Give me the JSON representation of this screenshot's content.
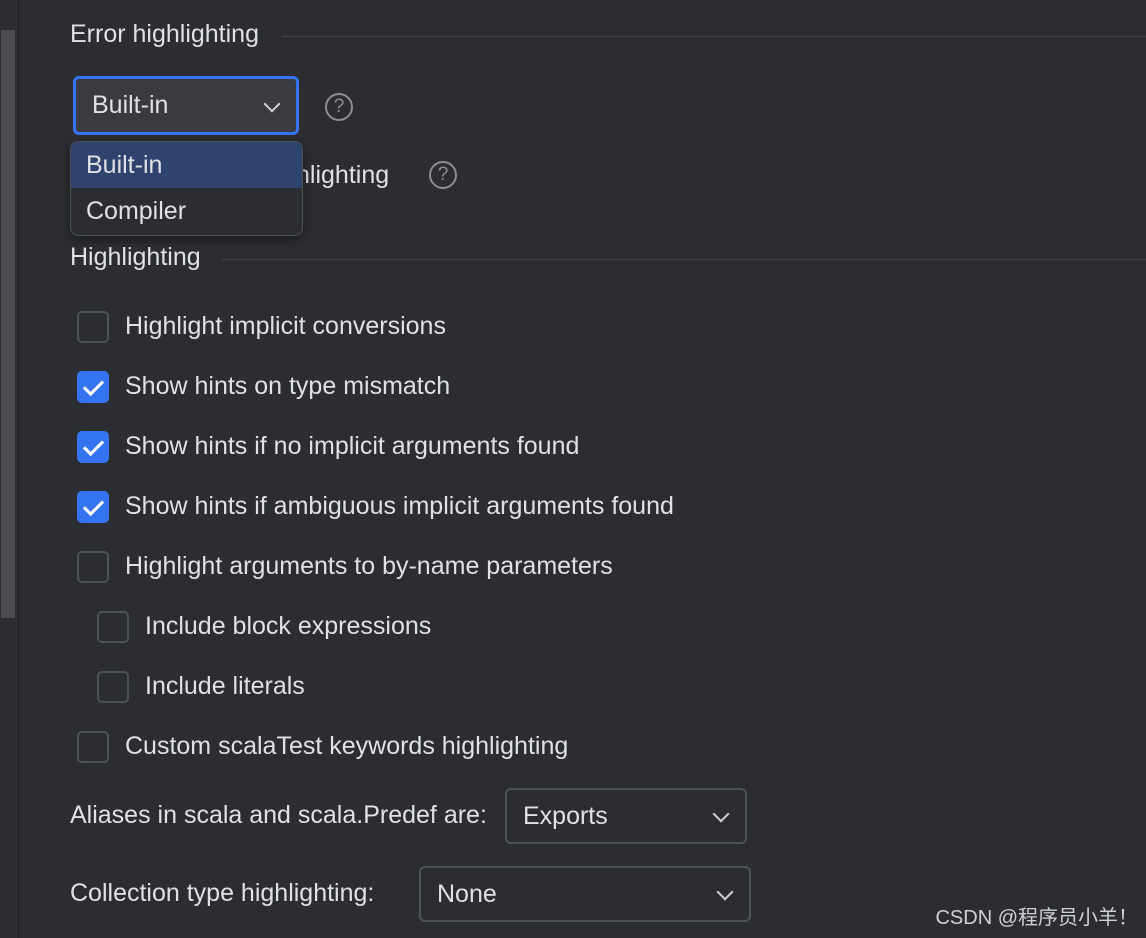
{
  "error_highlighting": {
    "title": "Error highlighting",
    "combo_value": "Built-in",
    "help_icon": "?",
    "partial_label": "hlighting",
    "popup_options": [
      "Built-in",
      "Compiler"
    ],
    "popup_selected": "Built-in"
  },
  "highlighting": {
    "title": "Highlighting",
    "checkboxes": [
      {
        "label": "Highlight implicit conversions",
        "checked": false
      },
      {
        "label": "Show hints on type mismatch",
        "checked": true
      },
      {
        "label": "Show hints if no implicit arguments found",
        "checked": true
      },
      {
        "label": "Show hints if ambiguous implicit arguments found",
        "checked": true
      },
      {
        "label": "Highlight arguments to by-name parameters",
        "checked": false
      },
      {
        "label": "Include block expressions",
        "checked": false
      },
      {
        "label": "Include literals",
        "checked": false
      },
      {
        "label": "Custom scalaTest keywords highlighting",
        "checked": false
      }
    ]
  },
  "aliases": {
    "label": "Aliases in scala and scala.Predef are:",
    "value": "Exports"
  },
  "collection": {
    "label": "Collection type highlighting:",
    "value": "None"
  },
  "watermark": "CSDN @程序员小羊！",
  "colors": {
    "accent": "#3574f0",
    "background": "#2b2d30",
    "selection": "#2e436e"
  }
}
